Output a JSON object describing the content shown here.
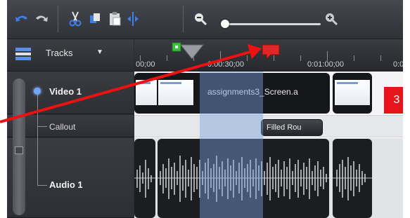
{
  "toolbar": {
    "buttons": [
      "undo-icon",
      "redo-icon",
      "cut-icon",
      "copy-icon",
      "paste-icon",
      "split-icon",
      "zoom-out-icon",
      "zoom-in-icon"
    ]
  },
  "tracks_header": {
    "label": "Tracks"
  },
  "ruler": {
    "labels": [
      "00;00",
      "0:00:30;00",
      "0:01:00;00",
      "0:0"
    ]
  },
  "tracks": [
    {
      "name": "Video 1"
    },
    {
      "name": "Callout"
    },
    {
      "name": "Audio 1"
    }
  ],
  "clips": {
    "video_label": "assignments3_Screen.a",
    "callout_label": "Filled Rou"
  },
  "annotation": {
    "badge": "3",
    "color": "#e8141c"
  },
  "colors": {
    "selection": "#78a0dc",
    "accent": "#e8141c",
    "marker_green": "#39c43c"
  }
}
